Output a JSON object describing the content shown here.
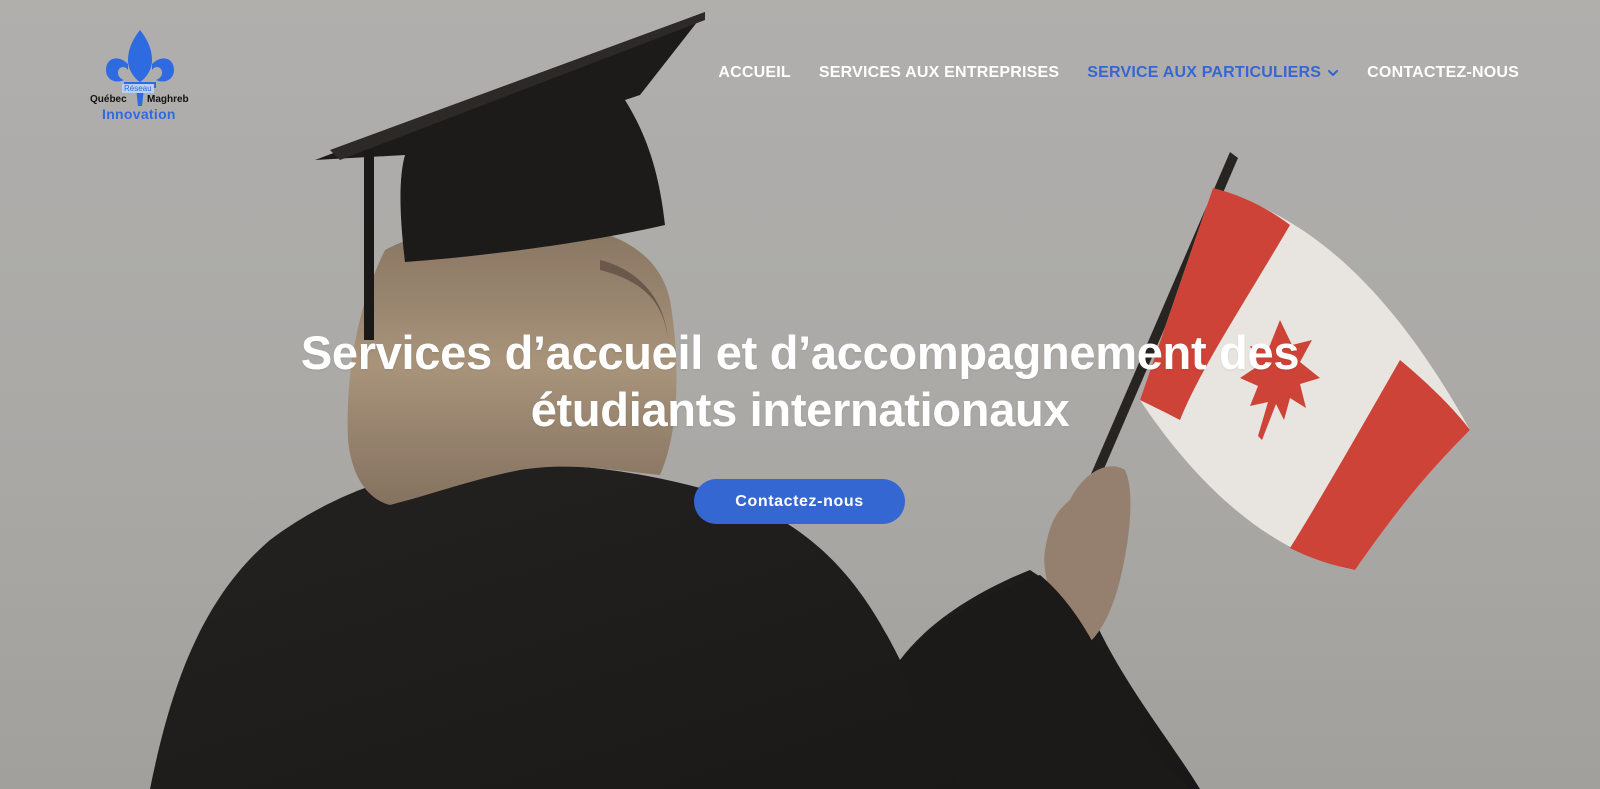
{
  "logo": {
    "line_left": "Québec",
    "line_right": "Maghreb",
    "tag": "Réseau",
    "brand": "Innovation",
    "icon": "fleur-de-lis-icon",
    "color": "#2f6be0"
  },
  "nav": {
    "items": [
      {
        "label": "ACCUEIL"
      },
      {
        "label": "SERVICES AUX ENTREPRISES"
      },
      {
        "label": "SERVICE AUX PARTICULIERS",
        "active": true,
        "icon": "chevron-down-icon"
      },
      {
        "label": "CONTACTEZ-NOUS"
      }
    ],
    "active_color": "#3567d3"
  },
  "hero": {
    "title": "Services d’accueil et d’accompagnement des étudiants internationaux",
    "cta_label": "Contactez-nous",
    "cta_color": "#3567d3",
    "image": "graduate-holding-canadian-flag"
  }
}
